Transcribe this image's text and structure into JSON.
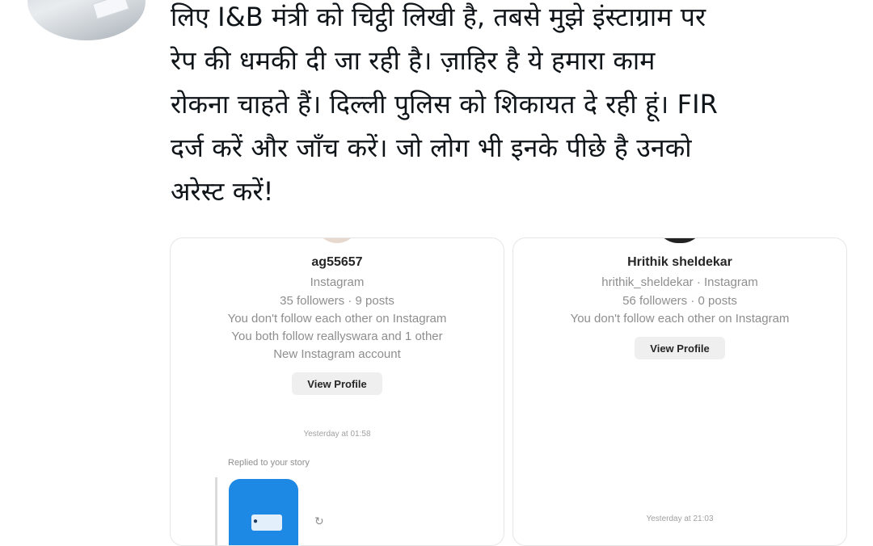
{
  "tweet": {
    "text": "लिए I&B मंत्री को चिट्ठी लिखी है, तबसे मुझे इंस्टाग्राम पर\nरेप की धमकी दी जा रही है। ज़ाहिर है ये हमारा काम\nरोकना चाहते हैं। दिल्ली पुलिस को शिकायत दे रही हूं। FIR\nदर्ज करें और जाँच करें। जो लोग भी इनके पीछे है उनको\nअरेस्ट करें!"
  },
  "cards": {
    "left": {
      "username": "ag55657",
      "subtitle": "Instagram",
      "stats": "35 followers · 9 posts",
      "follow_status": "You don't follow each other on Instagram",
      "mutual": "You both follow reallyswara and 1 other",
      "account_note": "New Instagram account",
      "button_label": "View Profile",
      "timestamp": "Yesterday at 01:58",
      "reply_label": "Replied to your story"
    },
    "right": {
      "username": "Hrithik sheldekar",
      "subtitle": "hrithik_sheldekar · Instagram",
      "stats": "56 followers · 0 posts",
      "follow_status": "You don't follow each other on Instagram",
      "button_label": "View Profile",
      "timestamp": "Yesterday at 21:03"
    }
  },
  "icons": {
    "tweet_avatar": "profile-photo",
    "story_thumbnail": "story-image",
    "reaction": "reaction-icon"
  },
  "colors": {
    "instagram_story_blue": "#1e88e5",
    "button_bg": "#efefef",
    "muted_text": "#8e8e8e"
  }
}
